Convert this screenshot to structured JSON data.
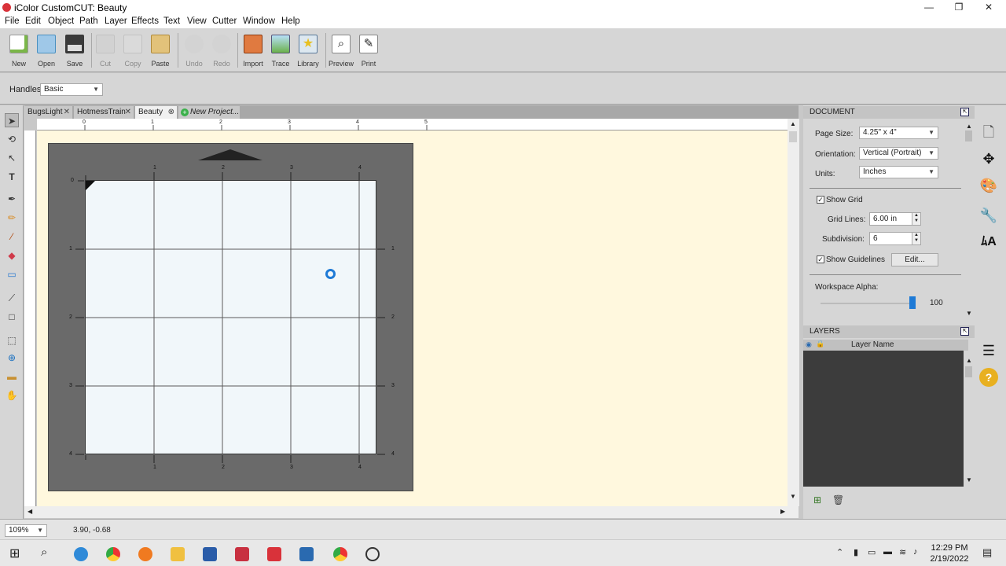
{
  "window": {
    "title": "iColor CustomCUT: Beauty",
    "minimize": "—",
    "maximize": "❐",
    "close": "✕"
  },
  "menu": [
    "File",
    "Edit",
    "Object",
    "Path",
    "Layer",
    "Effects",
    "Text",
    "View",
    "Cutter",
    "Window",
    "Help"
  ],
  "toolbar": [
    {
      "label": "New",
      "icon": "new-doc-icon",
      "color": "#7ab648",
      "enabled": true
    },
    {
      "label": "Open",
      "icon": "open-folder-icon",
      "color": "#4a90c0",
      "enabled": true
    },
    {
      "label": "Save",
      "icon": "save-disk-icon",
      "color": "#333333",
      "enabled": true
    },
    {
      "label": "Cut",
      "icon": "cut-icon",
      "color": "#999999",
      "enabled": false
    },
    {
      "label": "Copy",
      "icon": "copy-icon",
      "color": "#999999",
      "enabled": false
    },
    {
      "label": "Paste",
      "icon": "paste-icon",
      "color": "#c49a3a",
      "enabled": true
    },
    {
      "label": "Undo",
      "icon": "undo-icon",
      "color": "#999999",
      "enabled": false
    },
    {
      "label": "Redo",
      "icon": "redo-icon",
      "color": "#999999",
      "enabled": false
    },
    {
      "label": "Import",
      "icon": "import-svg-icon",
      "color": "#c84b1e",
      "enabled": true
    },
    {
      "label": "Trace",
      "icon": "trace-icon",
      "color": "#4aa0d0",
      "enabled": true
    },
    {
      "label": "Library",
      "icon": "library-star-icon",
      "color": "#e8c020",
      "enabled": true
    },
    {
      "label": "Preview",
      "icon": "preview-magnifier-icon",
      "color": "#555555",
      "enabled": true
    },
    {
      "label": "Print",
      "icon": "print-icon",
      "color": "#444444",
      "enabled": true
    }
  ],
  "options": {
    "handles_label": "Handles:",
    "handles_value": "Basic"
  },
  "tabs": [
    {
      "label": "BugsLight",
      "active": false
    },
    {
      "label": "HotmessTrain",
      "active": false
    },
    {
      "label": "Beauty",
      "active": true
    },
    {
      "label": "New Project...",
      "active": false,
      "new": true
    }
  ],
  "ruler_top": [
    "0",
    "1",
    "2",
    "3",
    "4",
    "5"
  ],
  "mat_top": [
    "1",
    "2",
    "3",
    "4"
  ],
  "mat_bottom": [
    "1",
    "2",
    "3",
    "4"
  ],
  "mat_left": [
    "0",
    "1",
    "2",
    "3",
    "4"
  ],
  "mat_right": [
    "1",
    "2",
    "3",
    "4"
  ],
  "status": {
    "zoom": "109%",
    "coords": "3.90, -0.68"
  },
  "document": {
    "header": "DOCUMENT",
    "page_size_label": "Page Size:",
    "page_size": "4.25\" x 4\"",
    "orientation_label": "Orientation:",
    "orientation": "Vertical (Portrait)",
    "units_label": "Units:",
    "units": "Inches",
    "show_grid": "Show Grid",
    "grid_lines_label": "Grid Lines:",
    "grid_lines": "6.00 in",
    "subdivision_label": "Subdivision:",
    "subdivision": "6",
    "show_guidelines": "Show Guidelines",
    "edit_button": "Edit...",
    "workspace_alpha_label": "Workspace Alpha:",
    "workspace_alpha": "100"
  },
  "layers": {
    "header": "LAYERS",
    "column": "Layer Name"
  },
  "clock": {
    "time": "12:29 PM",
    "date": "2/19/2022"
  },
  "colors": {
    "canvas": "#fff8de",
    "mat": "#6a6a6a",
    "page": "#f1f7fa",
    "accent": "#1e7ad6"
  }
}
